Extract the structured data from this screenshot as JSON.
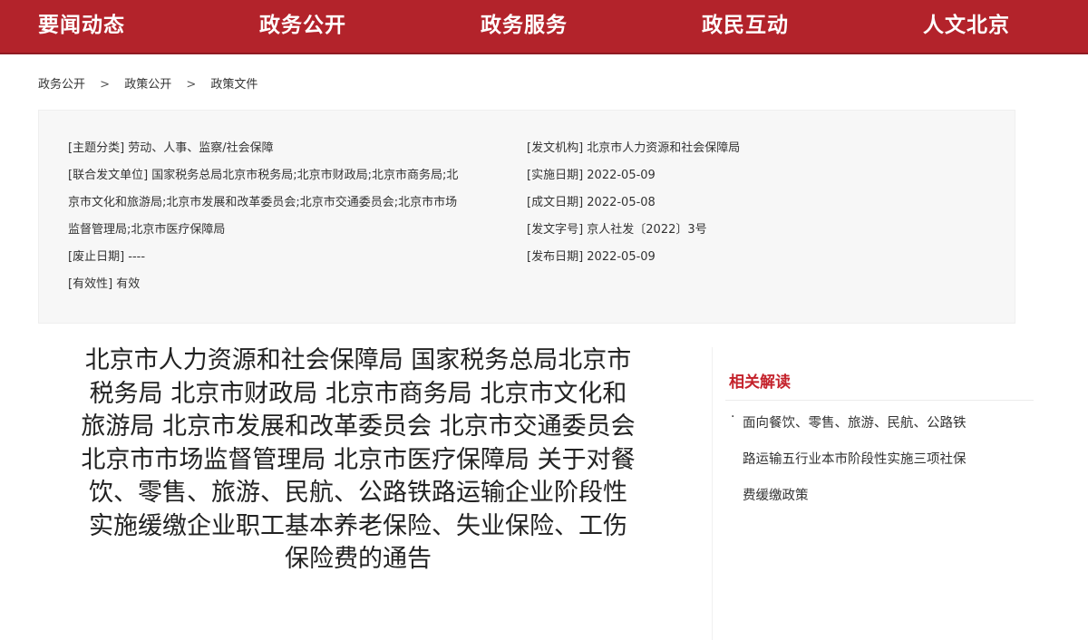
{
  "nav": {
    "items": [
      "要闻动态",
      "政务公开",
      "政务服务",
      "政民互动",
      "人文北京"
    ]
  },
  "breadcrumb": {
    "items": [
      "政务公开",
      "政策公开",
      "政策文件"
    ],
    "separator": ">"
  },
  "meta": {
    "left": [
      "[主题分类] 劳动、人事、监察/社会保障",
      "[联合发文单位] 国家税务总局北京市税务局;北京市财政局;北京市商务局;北",
      "京市文化和旅游局;北京市发展和改革委员会;北京市交通委员会;北京市市场",
      "监督管理局;北京市医疗保障局",
      "[废止日期] ----",
      "[有效性] 有效"
    ],
    "right": [
      "[发文机构] 北京市人力资源和社会保障局",
      "[实施日期] 2022-05-09",
      "[成文日期] 2022-05-08",
      "[发文字号] 京人社发〔2022〕3号",
      "[发布日期] 2022-05-09"
    ]
  },
  "document": {
    "title_lines": [
      "北京市人力资源和社会保障局 国家税务总局北京市",
      "税务局 北京市财政局 北京市商务局 北京市文化和",
      "旅游局 北京市发展和改革委员会 北京市交通委员会",
      "北京市市场监督管理局 北京市医疗保障局 关于对餐",
      "饮、零售、旅游、民航、公路铁路运输企业阶段性",
      "实施缓缴企业职工基本养老保险、失业保险、工伤",
      "保险费的通告"
    ]
  },
  "related": {
    "title": "相关解读",
    "bullet": "·",
    "link_lines": [
      "面向餐饮、零售、旅游、民航、公路铁",
      "路运输五行业本市阶段性实施三项社保",
      "费缓缴政策"
    ]
  },
  "colors": {
    "brand_red": "#b3232b",
    "accent_red": "#c4222b"
  }
}
